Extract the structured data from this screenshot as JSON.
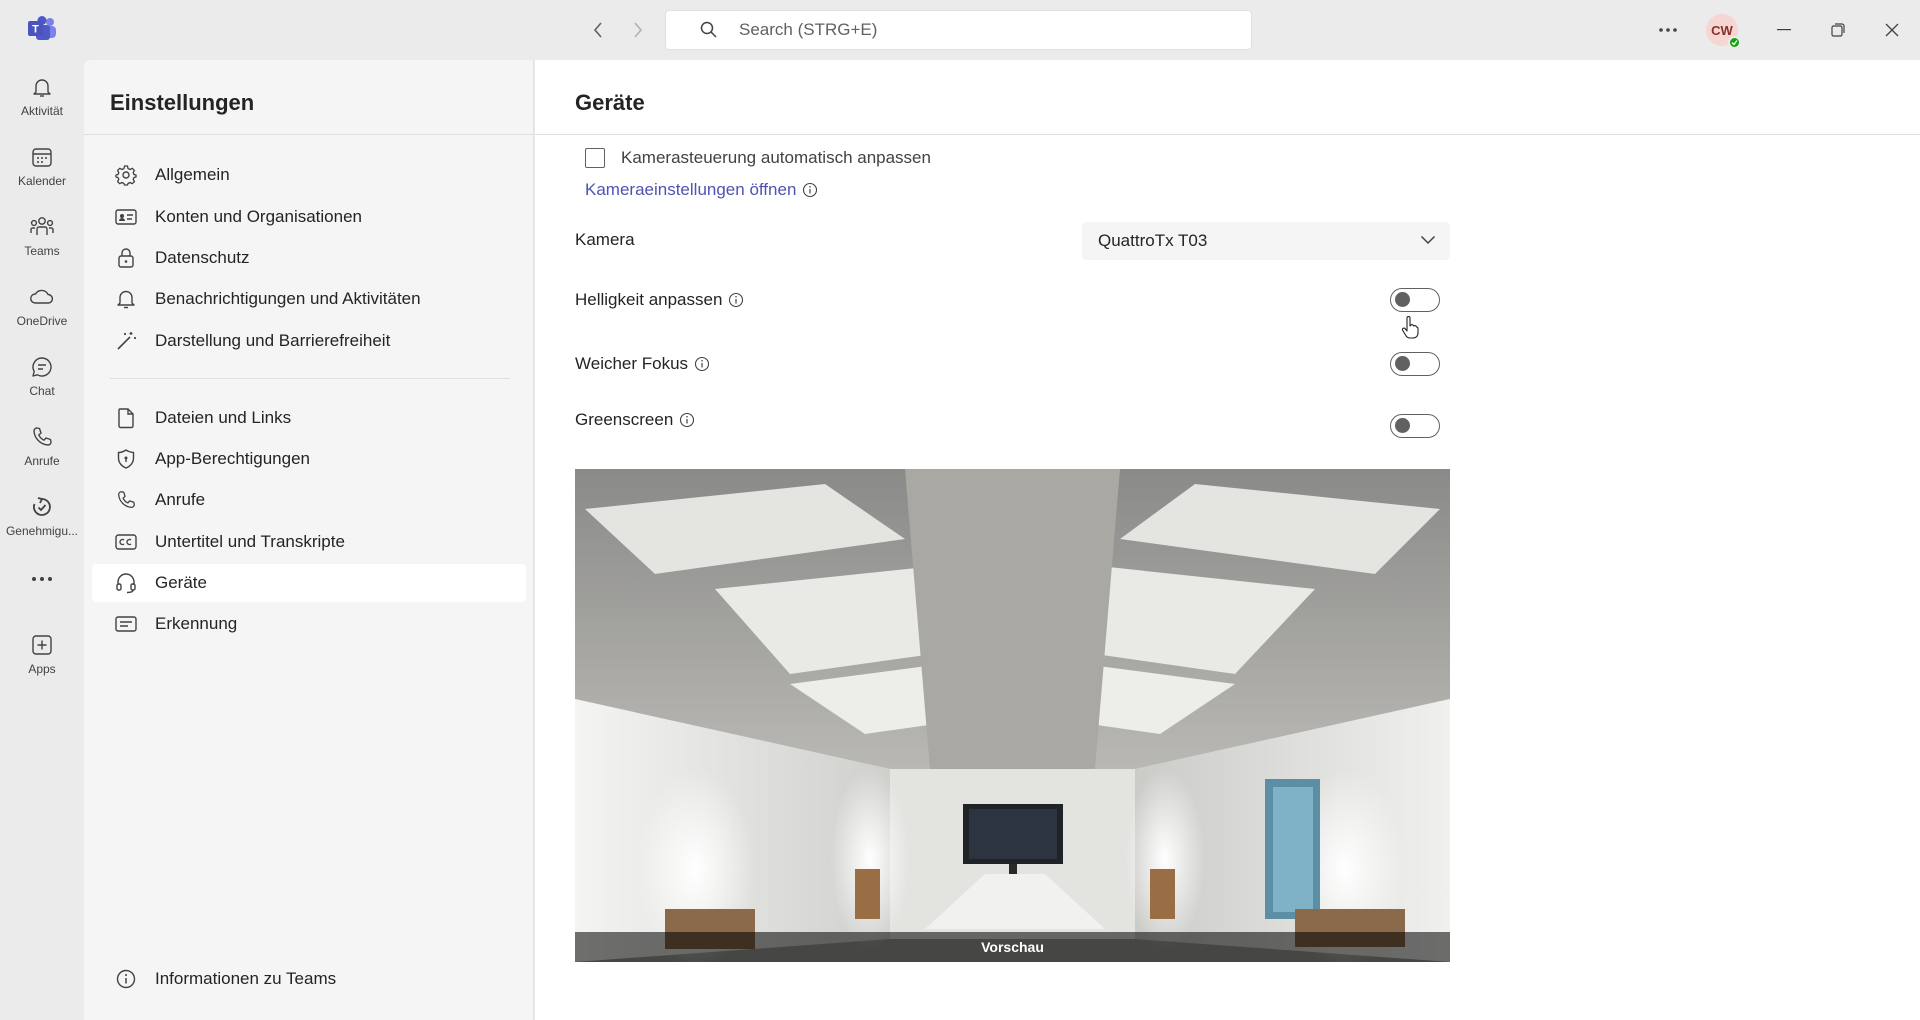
{
  "titlebar": {
    "search_placeholder": "Search (STRG+E)",
    "avatar_initials": "CW"
  },
  "rail": {
    "items": [
      {
        "label": "Aktivität",
        "icon": "bell-icon"
      },
      {
        "label": "Kalender",
        "icon": "calendar-icon"
      },
      {
        "label": "Teams",
        "icon": "teams-icon"
      },
      {
        "label": "OneDrive",
        "icon": "cloud-icon"
      },
      {
        "label": "Chat",
        "icon": "chat-icon"
      },
      {
        "label": "Anrufe",
        "icon": "phone-icon"
      },
      {
        "label": "Genehmigu...",
        "icon": "approvals-icon"
      },
      {
        "label": "",
        "icon": "more-icon"
      },
      {
        "label": "Apps",
        "icon": "add-apps-icon"
      }
    ]
  },
  "sidebar": {
    "title": "Einstellungen",
    "items": [
      {
        "label": "Allgemein",
        "icon": "gear-icon"
      },
      {
        "label": "Konten und Organisationen",
        "icon": "id-card-icon"
      },
      {
        "label": "Datenschutz",
        "icon": "lock-icon"
      },
      {
        "label": "Benachrichtigungen und Aktivitäten",
        "icon": "bell-icon"
      },
      {
        "label": "Darstellung und Barrierefreiheit",
        "icon": "magic-wand-icon"
      },
      {
        "label": "Dateien und Links",
        "icon": "document-icon"
      },
      {
        "label": "App-Berechtigungen",
        "icon": "shield-icon"
      },
      {
        "label": "Anrufe",
        "icon": "phone-icon"
      },
      {
        "label": "Untertitel und Transkripte",
        "icon": "closed-captions-icon"
      },
      {
        "label": "Geräte",
        "icon": "headset-icon",
        "active": true
      },
      {
        "label": "Erkennung",
        "icon": "text-lines-icon"
      }
    ],
    "footer_label": "Informationen zu Teams"
  },
  "main": {
    "title": "Geräte",
    "camera_control_label": "Kamerasteuerung automatisch anpassen",
    "camera_settings_link": "Kameraeinstellungen öffnen",
    "camera_label": "Kamera",
    "camera_value": "QuattroTx T03",
    "brightness_label": "Helligkeit anpassen",
    "soft_focus_label": "Weicher Fokus",
    "greenscreen_label": "Greenscreen",
    "preview_caption": "Vorschau"
  },
  "colors": {
    "link": "#4f52b2",
    "brand": "#5b5fc7",
    "presence_available": "#13a10e"
  }
}
